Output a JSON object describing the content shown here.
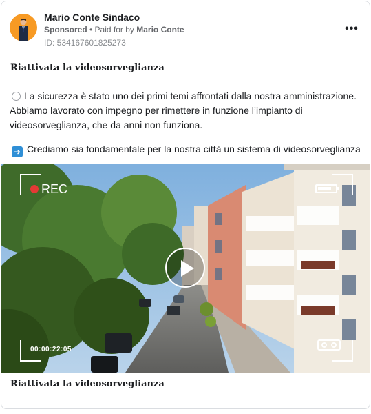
{
  "ad": {
    "page_name": "Mario Conte Sindaco",
    "sponsored_label": "Sponsored",
    "separator": " • ",
    "paid_for_prefix": "Paid for by ",
    "payer_name": "Mario Conte",
    "ad_id": "ID: 534167601825273",
    "more_options": "•••"
  },
  "post": {
    "title": "Riattivata la videosorveglianza",
    "paragraph_1": "La sicurezza è stato uno dei primi temi affrontati dalla nostra amministrazione. Abbiamo lavorato con impegno per rimettere in funzione l’impianto di videosorveglianza, che da anni non funziona.",
    "paragraph_2": "Crediamo sia fondamentale per la nostra città un sistema di videosorveglianza"
  },
  "video": {
    "rec_label": "REC",
    "timecode": "00:00:22:05",
    "battery_level": 0.8
  },
  "caption": "Riattivata la videosorveglianza",
  "icons": {
    "avatar": "candidate-portrait",
    "bullet_1": "white-circle-icon",
    "bullet_2": "right-arrow-icon",
    "play": "play-icon",
    "battery": "battery-icon",
    "tape": "cassette-icon"
  },
  "colors": {
    "avatar_bg": "#f79a24",
    "rec_dot": "#e53935",
    "arrow_icon_bg": "#2f8fd6",
    "meta_text": "#65676b"
  }
}
